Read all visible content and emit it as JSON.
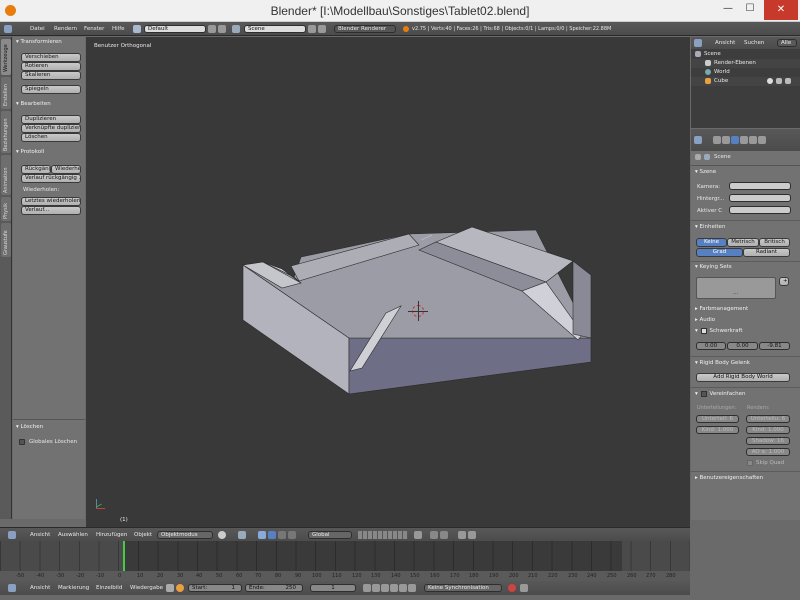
{
  "window": {
    "title": "Blender* [I:\\Modellbau\\Sonstiges\\Tablet02.blend]",
    "minimize": "—",
    "maximize": "☐",
    "close": "✕"
  },
  "topbar": {
    "menus": [
      "Datei",
      "Rendern",
      "Fenster",
      "Hilfe"
    ],
    "layout": "Default",
    "scene": "Scene",
    "engine": "Blender Renderer",
    "stats": "v2.75 | Verts:40 | Faces:26 | Tris:68 | Objects:0/1 | Lamps:0/0 | Speicher:22.88M"
  },
  "toolshelf": {
    "tabs": [
      "Werkzeuge",
      "Erstellen",
      "Beziehungen",
      "Animation",
      "Physik",
      "Graustufe"
    ],
    "transform_title": "Transformieren",
    "transform_buttons": [
      "Verschieben",
      "Rotieren",
      "Skalieren"
    ],
    "mirror": "Spiegeln",
    "edit_title": "Bearbeiten",
    "edit_buttons": [
      "Duplizieren",
      "Verknüpfte duplizieren",
      "Löschen"
    ],
    "history_title": "Protokoll",
    "undo": "Rückgängig",
    "redo": "Wiederher",
    "undo_history": "Verlauf rückgängig ...",
    "repeat_label": "Wiederholen:",
    "repeat_last": "Letztes wiederholen",
    "history": "Verlauf...",
    "op_title": "Löschen",
    "op_checkbox": "Globales Löschen"
  },
  "viewport": {
    "label": "Benutzer Orthogonal",
    "frame": "(1)",
    "header_menus": [
      "Ansicht",
      "Auswählen",
      "Hinzufügen",
      "Objekt"
    ],
    "mode": "Objektmodus",
    "orientation": "Global"
  },
  "outliner": {
    "tabs": [
      "Ansicht",
      "Suchen",
      "Alle"
    ],
    "items": [
      "Scene",
      "Render-Ebenen",
      "World",
      "Cube"
    ]
  },
  "properties": {
    "breadcrumb": "Scene",
    "scene_title": "Szene",
    "camera_label": "Kamera:",
    "background_label": "Hintergr...",
    "active_label": "Aktiver C",
    "units_title": "Einheiten",
    "unit_buttons": [
      "Keine",
      "Metrisch",
      "Britisch"
    ],
    "angle_buttons": [
      "Grad",
      "Radiant"
    ],
    "keying_title": "Keying Sets",
    "keying_field": "...",
    "color_mgmt": "Farbmanagement",
    "audio": "Audio",
    "gravity": "Schwerkraft",
    "gravity_x": "0.00",
    "gravity_y": "0.00",
    "gravity_z": "-9.81",
    "rigid_title": "Rigid Body Gelenk",
    "rigid_button": "Add Rigid Body World",
    "simplify": "Vereinfachen",
    "subdiv_label": "Unterteilungen:",
    "subdiv": "Unterteil: 6",
    "child": "Kind: 1.000",
    "render_label": "Rendern:",
    "render_subdiv": "Unterteilu: 6",
    "render_child": "Kind: 1.000",
    "shadow": "Shadow: 16",
    "ao": "AO a: 1.000",
    "skip_quad": "Skip Quad",
    "custom_props": "Benutzereigenschaften"
  },
  "timeline": {
    "ticks": [
      "-50",
      "-40",
      "-30",
      "-20",
      "-10",
      "0",
      "10",
      "20",
      "30",
      "40",
      "50",
      "60",
      "70",
      "80",
      "90",
      "100",
      "110",
      "120",
      "130",
      "140",
      "150",
      "160",
      "170",
      "180",
      "190",
      "200",
      "210",
      "220",
      "230",
      "240",
      "250",
      "260",
      "270",
      "280"
    ],
    "menus": [
      "Ansicht",
      "Markierung",
      "Einzelbild",
      "Wiedergabe"
    ],
    "start": "Start:",
    "start_val": "1",
    "end": "Ende:",
    "end_val": "250",
    "current": "1",
    "sync": "Keine Synchronisation"
  },
  "colors": {
    "accent": "#5680c2",
    "viewport_bg": "#393939",
    "panel_bg": "#727272"
  }
}
